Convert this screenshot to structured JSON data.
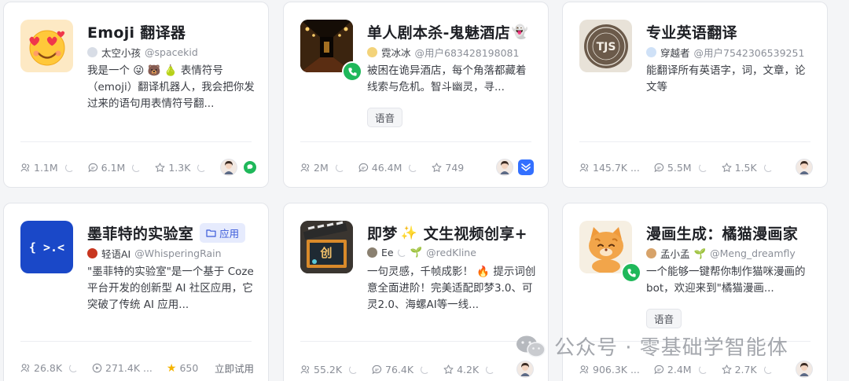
{
  "cards": [
    {
      "title": "Emoji 翻译器",
      "author_name": "太空小孩",
      "author_handle": "@spacekid",
      "description": "我是一个 😜 🐻 🍐 表情符号（emoji）翻译机器人，我会把你发过来的语句用表情符号翻...",
      "stats": {
        "users": "1.1M",
        "chats": "6.1M",
        "stars": "1.3K"
      },
      "avatar_icon": "heart-eyes-emoji-icon"
    },
    {
      "title": "单人剧本杀-鬼魅酒店",
      "title_emoji": "👻",
      "author_name": "霓冰冰",
      "author_handle": "@用户683428198081",
      "description": "被困在诡异酒店，每个角落都藏着线索与危机。智斗幽灵，寻...",
      "tag": "语音",
      "stats": {
        "users": "2M",
        "chats": "46.4M",
        "stars": "749"
      },
      "avatar_icon": "hotel-corridor-image"
    },
    {
      "title": "专业英语翻译",
      "author_name": "穿越者",
      "author_handle": "@用户7542306539251",
      "description": "能翻译所有英语字，词，文章，论文等",
      "stats": {
        "users": "145.7K ...",
        "chats": "5.5M",
        "stars": "1.5K"
      },
      "avatar_text": "TJS",
      "avatar_icon": "stamp-logo-icon"
    },
    {
      "title": "墨菲特的实验室",
      "app_badge": "应用",
      "author_name": "轻语AI",
      "author_handle": "@WhisperingRain",
      "description": "\"墨菲特的实验室\"是一个基于 Coze 平台开发的创新型 AI 社区应用，它突破了传统 AI 应用...",
      "stats": {
        "users": "26.8K",
        "chats": "271.4K ...",
        "stars": "650"
      },
      "try_label": "立即试用",
      "avatar_text": "{ >.<",
      "avatar_icon": "code-face-icon"
    },
    {
      "title": "即梦",
      "title_emoji": "✨",
      "title_suffix": "文生视频创享+",
      "author_name": "Ee",
      "author_handle": "@redKline",
      "description": "一句灵感，千帧成影！ 🔥 提示词创意全面进阶！完美适配即梦3.0、可灵2.0、海螺AI等一线...",
      "stats": {
        "users": "55.2K",
        "chats": "76.4K",
        "stars": "4.2K"
      },
      "avatar_text": "创",
      "avatar_icon": "film-clapper-icon"
    },
    {
      "title": "漫画生成：橘猫漫画家",
      "author_name": "孟小孟",
      "author_handle": "@Meng_dreamfly",
      "description": "一个能够一键帮你制作猫咪漫画的bot，欢迎来到\"橘猫漫画...",
      "tag": "语音",
      "stats": {
        "users": "906.3K ...",
        "chats": "2.4M",
        "stars": "2.7K"
      },
      "avatar_icon": "orange-cat-icon"
    }
  ],
  "watermark": "公众号 · 零基础学智能体",
  "colors": {
    "phone_badge": "#1fb85a",
    "app_badge_text": "#3a5ad9",
    "star_fill": "#f5b400"
  }
}
